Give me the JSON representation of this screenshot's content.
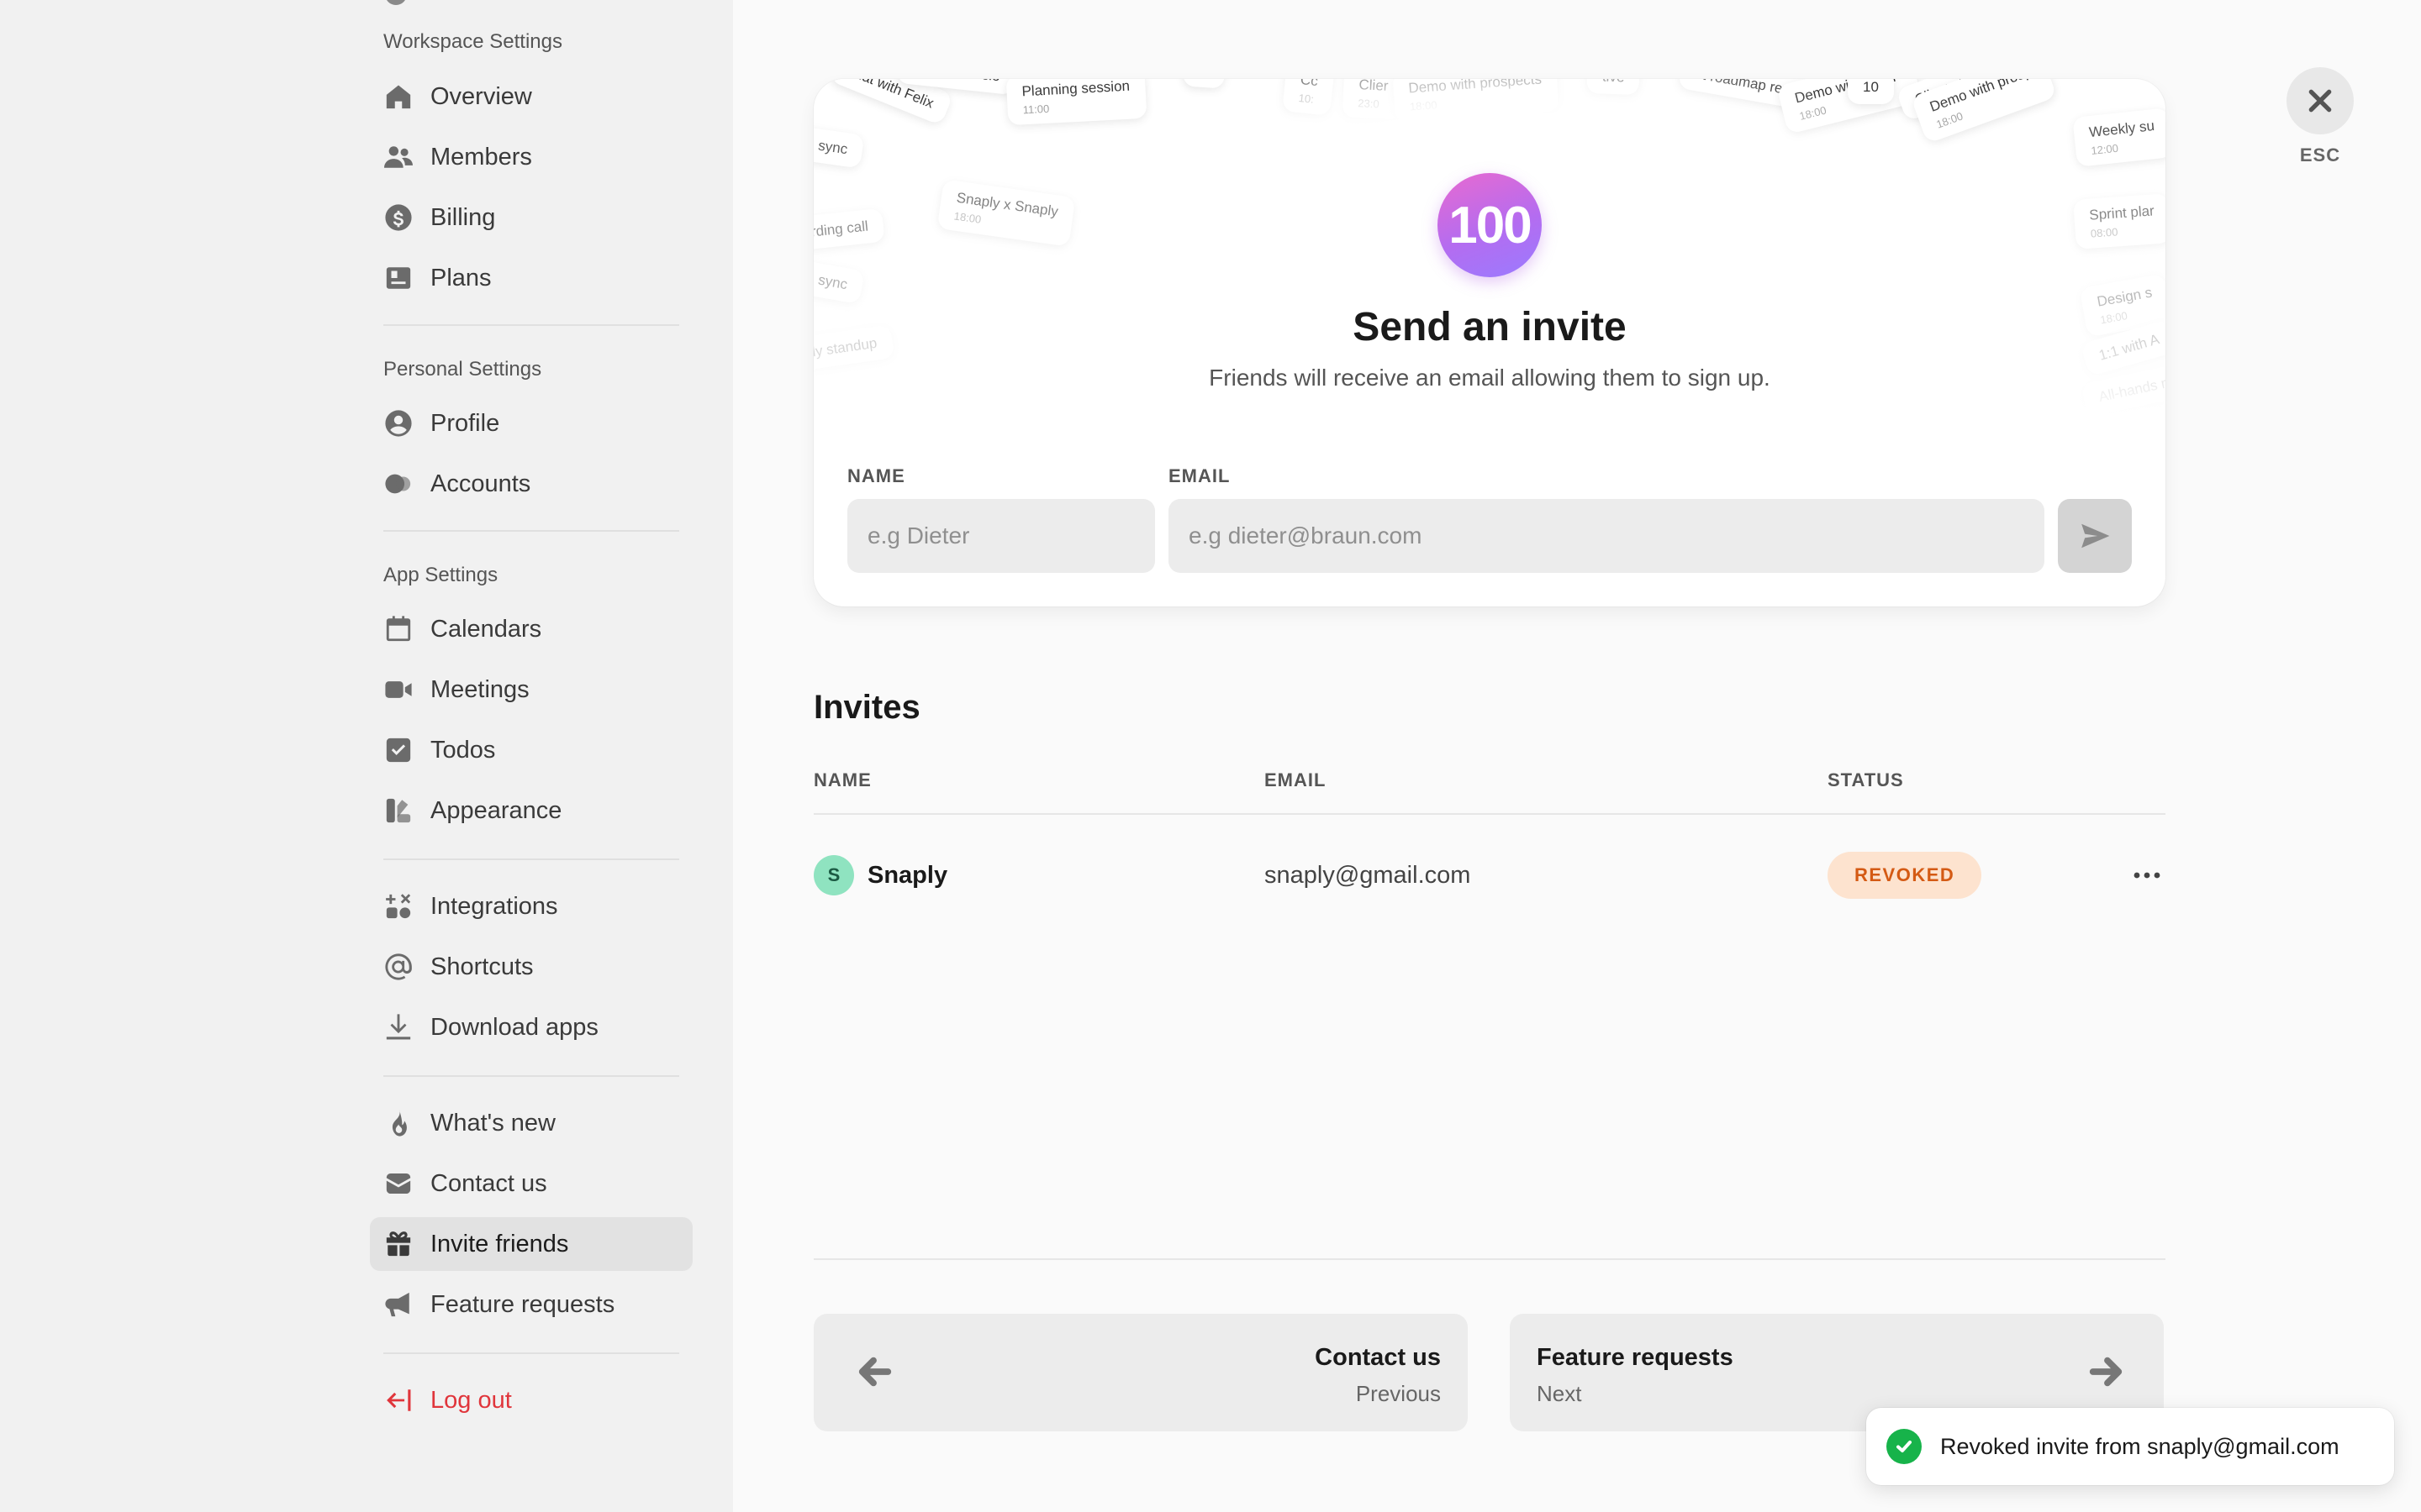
{
  "sidebar": {
    "sections": {
      "workspace": "Workspace Settings",
      "personal": "Personal Settings",
      "app": "App Settings"
    },
    "items": {
      "overview": "Overview",
      "members": "Members",
      "billing": "Billing",
      "plans": "Plans",
      "profile": "Profile",
      "accounts": "Accounts",
      "calendars": "Calendars",
      "meetings": "Meetings",
      "todos": "Todos",
      "appearance": "Appearance",
      "integrations": "Integrations",
      "shortcuts": "Shortcuts",
      "download_apps": "Download apps",
      "whats_new": "What's new",
      "contact_us": "Contact us",
      "invite_friends": "Invite friends",
      "feature_requests": "Feature requests",
      "log_out": "Log out"
    },
    "active": "invite_friends"
  },
  "close": {
    "label": "ESC"
  },
  "invite_card": {
    "badge": "100",
    "title": "Send an invite",
    "subtitle": "Friends will receive an email allowing them to sign up.",
    "name_label": "NAME",
    "name_placeholder": "e.g Dieter",
    "email_label": "EMAIL",
    "email_placeholder": "e.g dieter@braun.com",
    "decor_chips": [
      {
        "title": "chat with Felix",
        "time": ""
      },
      {
        "title": "anning sessio",
        "time": ""
      },
      {
        "title": "Planning session",
        "time": "11:00"
      },
      {
        "title": "ts",
        "time": ""
      },
      {
        "title": "Cc",
        "time": "10:"
      },
      {
        "title": "Clier",
        "time": "23:0"
      },
      {
        "title": "Demo with prospects",
        "time": "18:00"
      },
      {
        "title": "tive",
        "time": ""
      },
      {
        "title": "ct roadmap review",
        "time": ""
      },
      {
        "title": "Demo with prosp",
        "time": "18:00"
      },
      {
        "title": "10",
        "time": ""
      },
      {
        "title": "Client check",
        "time": ""
      },
      {
        "title": "Demo with prosp",
        "time": "18:00"
      },
      {
        "title": "Weekly su",
        "time": "12:00"
      },
      {
        "title": "ign sync",
        "time": ""
      },
      {
        "title": "Snaply x Snaply",
        "time": "18:00"
      },
      {
        "title": "parding call",
        "time": ""
      },
      {
        "title": "ign sync",
        "time": ""
      },
      {
        "title": "ly standup",
        "time": ""
      },
      {
        "title": "Sprint plar",
        "time": "08:00"
      },
      {
        "title": "Design s",
        "time": "18:00"
      },
      {
        "title": "1:1 with A",
        "time": ""
      },
      {
        "title": "All-hands m",
        "time": ""
      }
    ]
  },
  "invites": {
    "title": "Invites",
    "columns": {
      "name": "NAME",
      "email": "EMAIL",
      "status": "STATUS"
    },
    "rows": [
      {
        "initial": "S",
        "name": "Snaply",
        "email": "snaply@gmail.com",
        "status": "REVOKED"
      }
    ]
  },
  "pager": {
    "prev": {
      "title": "Contact us",
      "sub": "Previous"
    },
    "next": {
      "title": "Feature requests",
      "sub": "Next"
    }
  },
  "toast": {
    "message": "Revoked invite from snaply@gmail.com"
  },
  "colors": {
    "danger": "#e0353b",
    "status_revoked_bg": "#fde3cf",
    "status_revoked_fg": "#d45a14",
    "avatar_bg": "#8fe3c0",
    "toast_success": "#17b34a"
  }
}
